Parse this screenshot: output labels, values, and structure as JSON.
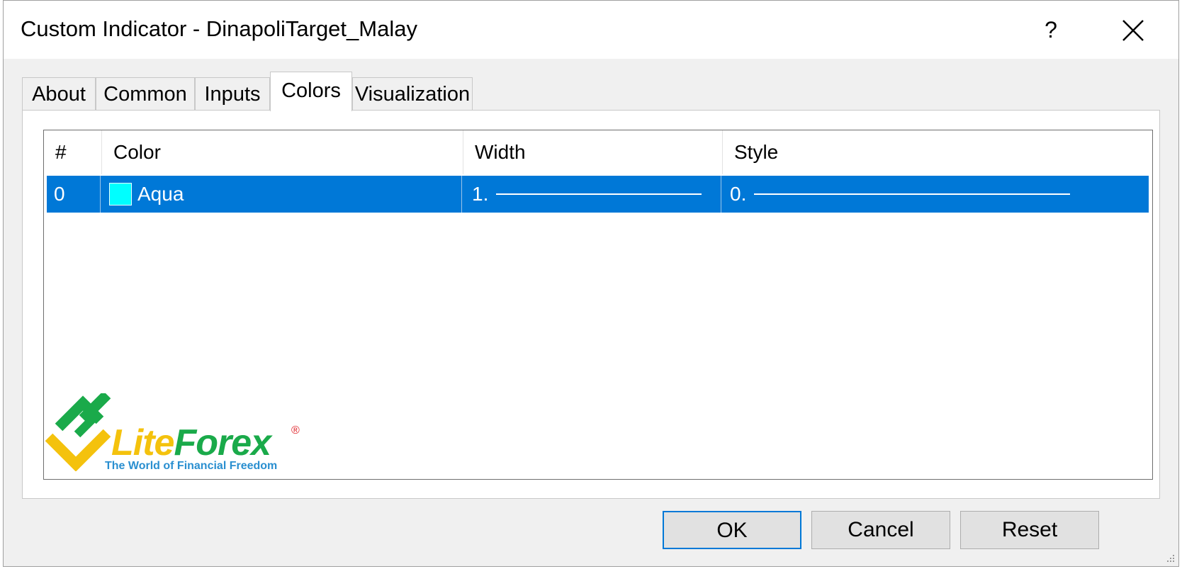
{
  "window": {
    "title": "Custom Indicator - DinapoliTarget_Malay",
    "help_label": "?",
    "close_icon": "close-icon"
  },
  "tabs": [
    {
      "label": "About",
      "active": false
    },
    {
      "label": "Common",
      "active": false
    },
    {
      "label": "Inputs",
      "active": false
    },
    {
      "label": "Colors",
      "active": true
    },
    {
      "label": "Visualization",
      "active": false
    }
  ],
  "grid": {
    "columns": [
      "#",
      "Color",
      "Width",
      "Style"
    ],
    "rows": [
      {
        "index": "0",
        "color_name": "Aqua",
        "color_hex": "#00ffff",
        "width": "1.",
        "style": "0.",
        "selected": true
      }
    ],
    "selection_color": "#0078d7"
  },
  "logo": {
    "brand_part1": "Lite",
    "brand_part2": "Forex",
    "registered": "®",
    "slogan": "The World of Financial Freedom",
    "colors": {
      "green": "#1aaa4a",
      "yellow": "#f4c20d",
      "blue": "#2a8fd0"
    }
  },
  "buttons": {
    "ok": "OK",
    "cancel": "Cancel",
    "reset": "Reset"
  }
}
